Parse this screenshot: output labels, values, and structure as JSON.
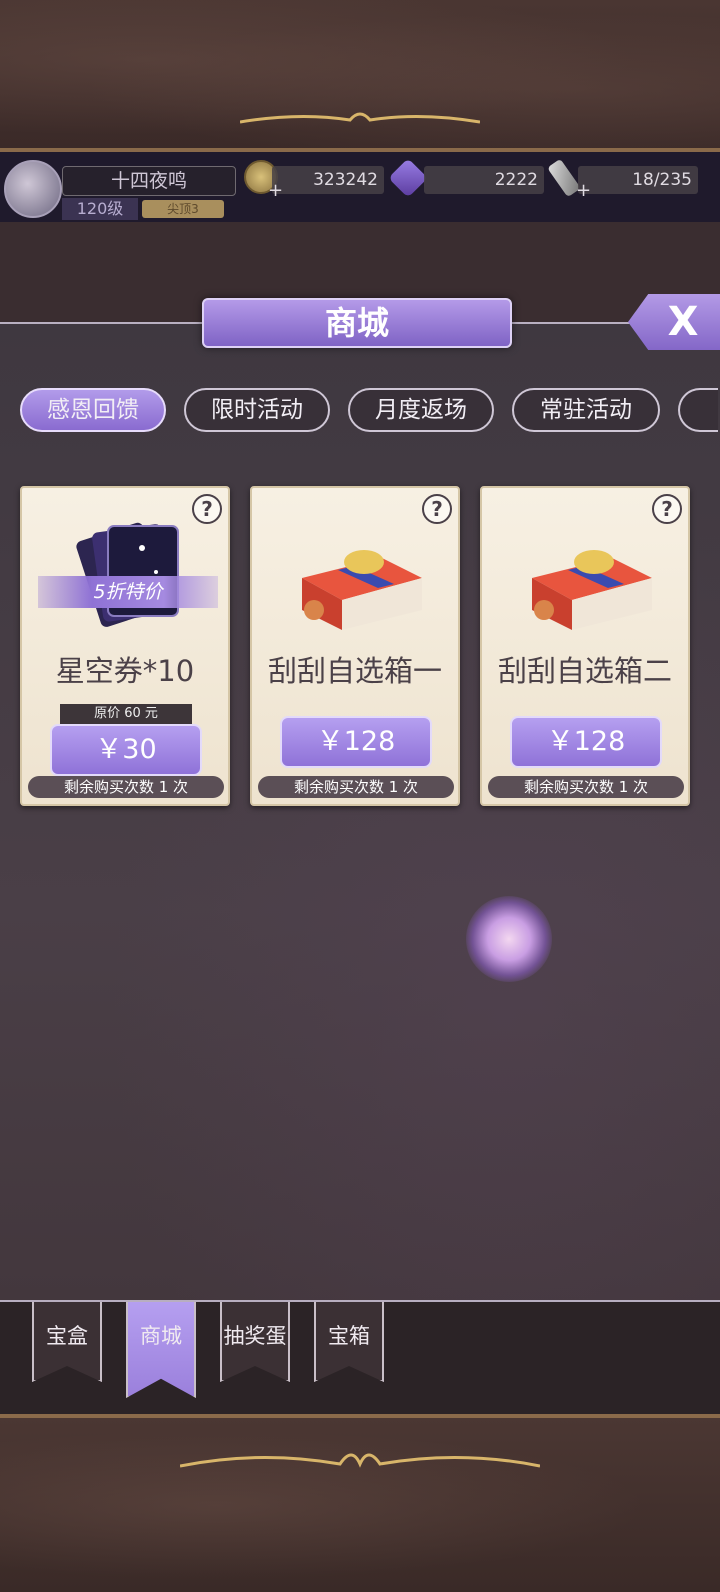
{
  "player": {
    "name": "十四夜鸣",
    "level": "120级",
    "rank": "尖顶3"
  },
  "resources": {
    "coins": "323242",
    "gems": "2222",
    "stamina": "18/235",
    "plus": "+"
  },
  "panel": {
    "title": "商城",
    "close_label": "X"
  },
  "tabs": [
    {
      "label": "感恩回馈",
      "active": true
    },
    {
      "label": "限时活动",
      "active": false
    },
    {
      "label": "月度返场",
      "active": false
    },
    {
      "label": "常驻活动",
      "active": false
    }
  ],
  "cards": [
    {
      "name": "星空券*10",
      "badge": "5折特价",
      "original_price": "原价 60 元",
      "price": "￥30",
      "remaining": "剩余购买次数 1 次",
      "help": "?",
      "icon": "star-ticket-icon"
    },
    {
      "name": "刮刮自选箱一",
      "price": "￥128",
      "remaining": "剩余购买次数 1 次",
      "help": "?",
      "icon": "gift-box-icon"
    },
    {
      "name": "刮刮自选箱二",
      "price": "￥128",
      "remaining": "剩余购买次数 1 次",
      "help": "?",
      "icon": "gift-box-icon"
    }
  ],
  "bottom_nav": [
    {
      "label": "宝盒",
      "active": false
    },
    {
      "label": "商城",
      "active": true
    },
    {
      "label": "抽奖蛋",
      "active": false
    },
    {
      "label": "宝箱",
      "active": false
    }
  ],
  "colors": {
    "accent_purple": "#9b80dc",
    "card_bg": "#f3eadb",
    "panel_bg": "#43373d"
  }
}
